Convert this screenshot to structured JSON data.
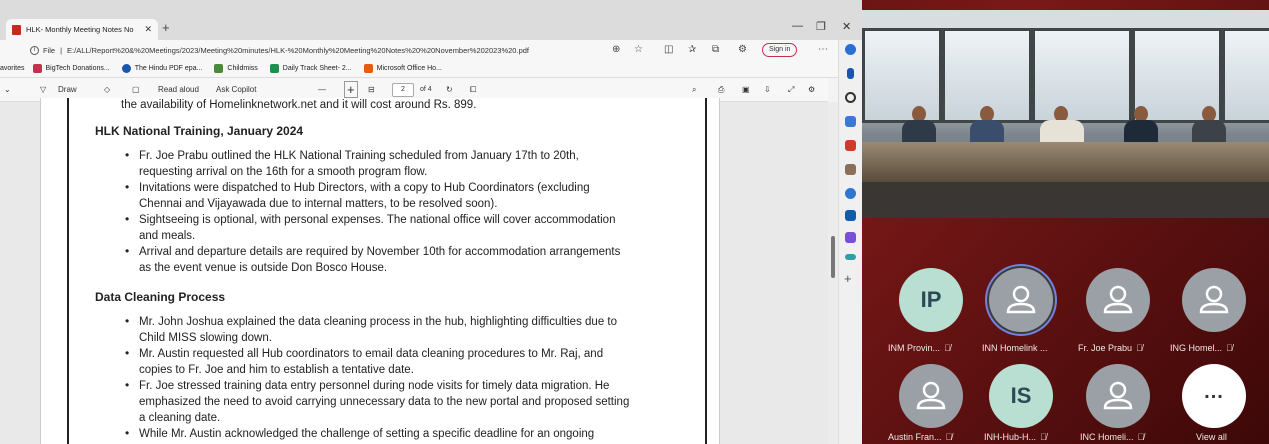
{
  "browser": {
    "tab_title": "HLK- Monthly Meeting Notes No",
    "url_prefix": "File",
    "url": "E:/ALL/Report%20&%20Meetings/2023/Meeting%20minutes/HLK-%20Monthly%20Meeting%20Notes%20%20November%202023%20.pdf",
    "signin_label": "Sign in",
    "favorites_label": "avorites",
    "favorites": [
      {
        "label": "BigTech Donations...",
        "color": "#c4314b"
      },
      {
        "label": "The Hindu PDF epa...",
        "color": "#1a56b0"
      },
      {
        "label": "Childmiss",
        "color": "#4a8a3a"
      },
      {
        "label": "Daily Track Sheet- 2...",
        "color": "#1f8f4e"
      },
      {
        "label": "Microsoft Office Ho...",
        "color": "#e55b13"
      }
    ]
  },
  "pdf_toolbar": {
    "draw": "Draw",
    "read_aloud": "Read aloud",
    "ask_copilot": "Ask Copilot",
    "page_current": "2",
    "page_total": "of 4"
  },
  "document": {
    "lines": [
      "the availability of Homelinknetwork.net and it will cost around Rs. 899.",
      "HLK National Training, January 2024",
      "Fr. Joe Prabu outlined the HLK National Training scheduled from January 17th to 20th,",
      "requesting arrival on the 16th for a smooth program flow.",
      "Invitations were dispatched to Hub Directors, with a copy to Hub Coordinators (excluding",
      "Chennai and Vijayawada due to internal matters, to be resolved soon).",
      "Sightseeing is optional, with personal expenses. The national office will cover accommodation",
      "and meals.",
      "Arrival and departure details are required by November 10th for accommodation arrangements",
      "as the event venue is outside Don Bosco House.",
      "Data Cleaning Process",
      "Mr. John Joshua explained the data cleaning process in the hub, highlighting difficulties due to",
      "Child MISS slowing down.",
      "Mr. Austin requested all Hub coordinators to email data cleaning procedures to Mr. Raj, and",
      "copies to Fr. Joe and him to establish a tentative date.",
      "Fr. Joe stressed training data entry personnel during node visits for timely data migration. He",
      "emphasized the need to avoid carrying unnecessary data to the new portal and proposed setting",
      "a cleaning date.",
      "While Mr. Austin acknowledged the challenge of setting a specific deadline for an ongoing"
    ]
  },
  "teams": {
    "participants": [
      {
        "initials": "IP",
        "name": "INM Provin...",
        "muted": true
      },
      {
        "initials": "",
        "name": "INN Homelink ...",
        "muted": false
      },
      {
        "initials": "",
        "name": "Fr. Joe Prabu",
        "muted": true
      },
      {
        "initials": "",
        "name": "ING Homel...",
        "muted": true
      },
      {
        "initials": "",
        "name": "Austin Fran...",
        "muted": true
      },
      {
        "initials": "IS",
        "name": "INH-Hub-H...",
        "muted": true
      },
      {
        "initials": "",
        "name": "INC Homeli...",
        "muted": true
      },
      {
        "initials": "",
        "name": "View all",
        "muted": false
      }
    ],
    "more_glyph": "..."
  }
}
